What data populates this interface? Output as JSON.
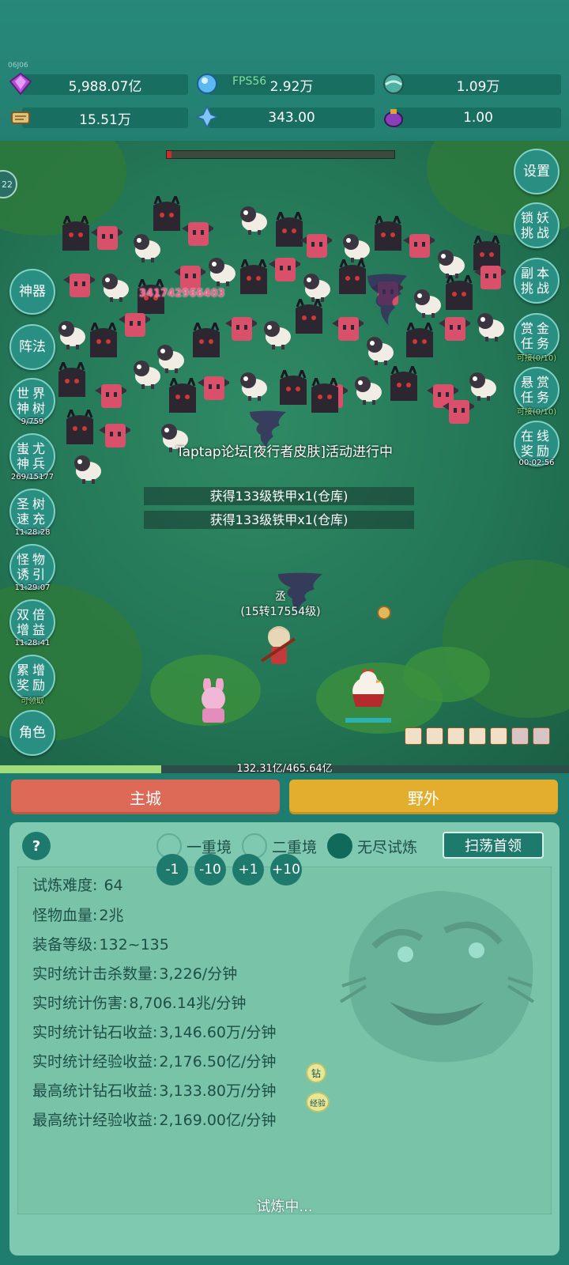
{
  "top": {
    "tiny_tag": "06J06",
    "fps": "FPS56",
    "resources": [
      {
        "icon": "purple-gem-icon",
        "value": "5,988.07亿"
      },
      {
        "icon": "blue-crystal-icon",
        "value": "2.92万"
      },
      {
        "icon": "teal-orb-icon",
        "value": "1.09万"
      },
      {
        "icon": "scroll-icon",
        "value": "15.51万"
      },
      {
        "icon": "ice-shard-icon",
        "value": "343.00"
      },
      {
        "icon": "potion-pot-icon",
        "value": "1.00"
      }
    ]
  },
  "field": {
    "left_dot": "22",
    "boss_hp_fraction": 0.02,
    "damage_number": "341742966403",
    "announcement": "Taptap论坛[夜行者皮肤]活动进行中",
    "loot_messages": [
      "获得133级铁甲x1(仓库)",
      "获得133级铁甲x1(仓库)"
    ],
    "player_name": "丞",
    "player_level": "(15转17554级)",
    "xp_fraction": 0.284,
    "xp_text": "132.31亿/465.64亿"
  },
  "left_menu": [
    {
      "label": "神器",
      "sub": ""
    },
    {
      "label": "阵法",
      "sub": ""
    },
    {
      "label": "世界神树",
      "sub": "9/759"
    },
    {
      "label": "蚩尤神兵",
      "sub": "269/15177"
    },
    {
      "label": "圣树速充",
      "sub": "11:28:28"
    },
    {
      "label": "怪物诱引",
      "sub": "11:29:07"
    },
    {
      "label": "双倍增益",
      "sub": "11:28:41"
    },
    {
      "label": "累增奖励",
      "sub": "可领取"
    },
    {
      "label": "角色",
      "sub": ""
    }
  ],
  "right_menu": [
    {
      "label": "设置",
      "sub": ""
    },
    {
      "label": "锁妖挑战",
      "sub": ""
    },
    {
      "label": "副本挑战",
      "sub": ""
    },
    {
      "label": "赏金任务",
      "sub": "可接(0/10)"
    },
    {
      "label": "悬赏任务",
      "sub": "可接(0/10)"
    },
    {
      "label": "在线奖励",
      "sub": "00:02:56"
    }
  ],
  "tabs": {
    "main_city": "主城",
    "wild": "野外"
  },
  "panel": {
    "help": "?",
    "modes": [
      {
        "label": "一重境",
        "selected": false
      },
      {
        "label": "二重境",
        "selected": false
      },
      {
        "label": "无尽试炼",
        "selected": true
      }
    ],
    "sweep_label": "扫荡首领",
    "difficulty_label": "试炼难度:",
    "difficulty_value": "64",
    "steps": [
      "-1",
      "-10",
      "+1",
      "+10"
    ],
    "stats": [
      {
        "label": "怪物血量:",
        "value": "2兆"
      },
      {
        "label": "装备等级:",
        "value": "132~135"
      },
      {
        "label": "实时统计击杀数量:",
        "value": "3,226/分钟"
      },
      {
        "label": "实时统计伤害:",
        "value": "8,706.14兆/分钟"
      },
      {
        "label": "实时统计钻石收益:",
        "value": "3,146.60万/分钟"
      },
      {
        "label": "实时统计经验收益:",
        "value": "2,176.50亿/分钟"
      },
      {
        "label": "最高统计钻石收益:",
        "value": "3,133.80万/分钟"
      },
      {
        "label": "最高统计经验收益:",
        "value": "2,169.00亿/分钟"
      }
    ],
    "badges": [
      "钻",
      "经验"
    ],
    "status": "试炼中..."
  },
  "colors": {
    "main_city": "#dd6a56",
    "wild": "#e3ae2e",
    "accent": "#1f7a6e"
  }
}
